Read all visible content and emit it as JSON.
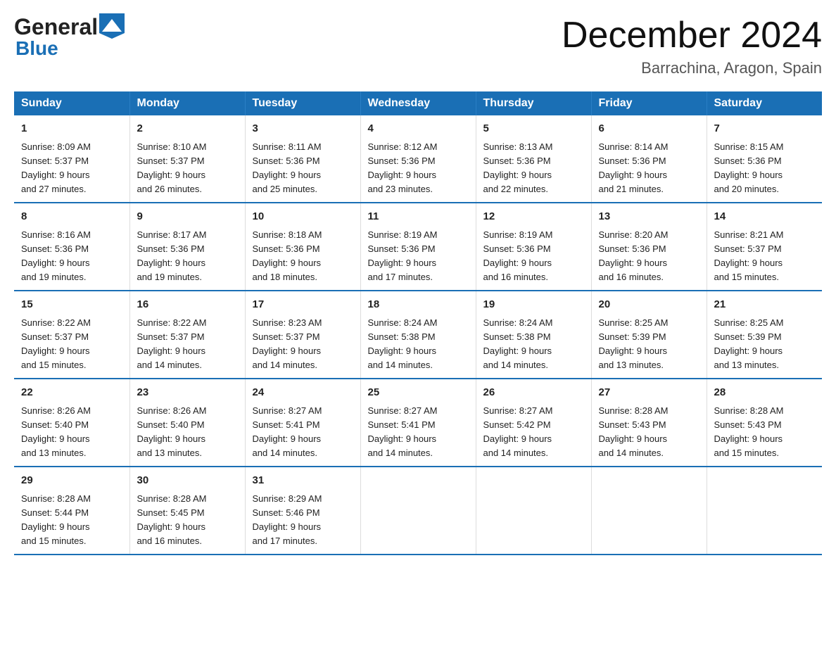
{
  "header": {
    "logo_general": "General",
    "logo_blue": "Blue",
    "title": "December 2024",
    "location": "Barrachina, Aragon, Spain"
  },
  "days_of_week": [
    "Sunday",
    "Monday",
    "Tuesday",
    "Wednesday",
    "Thursday",
    "Friday",
    "Saturday"
  ],
  "weeks": [
    [
      {
        "day": "1",
        "sunrise": "8:09 AM",
        "sunset": "5:37 PM",
        "daylight": "9 hours and 27 minutes."
      },
      {
        "day": "2",
        "sunrise": "8:10 AM",
        "sunset": "5:37 PM",
        "daylight": "9 hours and 26 minutes."
      },
      {
        "day": "3",
        "sunrise": "8:11 AM",
        "sunset": "5:36 PM",
        "daylight": "9 hours and 25 minutes."
      },
      {
        "day": "4",
        "sunrise": "8:12 AM",
        "sunset": "5:36 PM",
        "daylight": "9 hours and 23 minutes."
      },
      {
        "day": "5",
        "sunrise": "8:13 AM",
        "sunset": "5:36 PM",
        "daylight": "9 hours and 22 minutes."
      },
      {
        "day": "6",
        "sunrise": "8:14 AM",
        "sunset": "5:36 PM",
        "daylight": "9 hours and 21 minutes."
      },
      {
        "day": "7",
        "sunrise": "8:15 AM",
        "sunset": "5:36 PM",
        "daylight": "9 hours and 20 minutes."
      }
    ],
    [
      {
        "day": "8",
        "sunrise": "8:16 AM",
        "sunset": "5:36 PM",
        "daylight": "9 hours and 19 minutes."
      },
      {
        "day": "9",
        "sunrise": "8:17 AM",
        "sunset": "5:36 PM",
        "daylight": "9 hours and 19 minutes."
      },
      {
        "day": "10",
        "sunrise": "8:18 AM",
        "sunset": "5:36 PM",
        "daylight": "9 hours and 18 minutes."
      },
      {
        "day": "11",
        "sunrise": "8:19 AM",
        "sunset": "5:36 PM",
        "daylight": "9 hours and 17 minutes."
      },
      {
        "day": "12",
        "sunrise": "8:19 AM",
        "sunset": "5:36 PM",
        "daylight": "9 hours and 16 minutes."
      },
      {
        "day": "13",
        "sunrise": "8:20 AM",
        "sunset": "5:36 PM",
        "daylight": "9 hours and 16 minutes."
      },
      {
        "day": "14",
        "sunrise": "8:21 AM",
        "sunset": "5:37 PM",
        "daylight": "9 hours and 15 minutes."
      }
    ],
    [
      {
        "day": "15",
        "sunrise": "8:22 AM",
        "sunset": "5:37 PM",
        "daylight": "9 hours and 15 minutes."
      },
      {
        "day": "16",
        "sunrise": "8:22 AM",
        "sunset": "5:37 PM",
        "daylight": "9 hours and 14 minutes."
      },
      {
        "day": "17",
        "sunrise": "8:23 AM",
        "sunset": "5:37 PM",
        "daylight": "9 hours and 14 minutes."
      },
      {
        "day": "18",
        "sunrise": "8:24 AM",
        "sunset": "5:38 PM",
        "daylight": "9 hours and 14 minutes."
      },
      {
        "day": "19",
        "sunrise": "8:24 AM",
        "sunset": "5:38 PM",
        "daylight": "9 hours and 14 minutes."
      },
      {
        "day": "20",
        "sunrise": "8:25 AM",
        "sunset": "5:39 PM",
        "daylight": "9 hours and 13 minutes."
      },
      {
        "day": "21",
        "sunrise": "8:25 AM",
        "sunset": "5:39 PM",
        "daylight": "9 hours and 13 minutes."
      }
    ],
    [
      {
        "day": "22",
        "sunrise": "8:26 AM",
        "sunset": "5:40 PM",
        "daylight": "9 hours and 13 minutes."
      },
      {
        "day": "23",
        "sunrise": "8:26 AM",
        "sunset": "5:40 PM",
        "daylight": "9 hours and 13 minutes."
      },
      {
        "day": "24",
        "sunrise": "8:27 AM",
        "sunset": "5:41 PM",
        "daylight": "9 hours and 14 minutes."
      },
      {
        "day": "25",
        "sunrise": "8:27 AM",
        "sunset": "5:41 PM",
        "daylight": "9 hours and 14 minutes."
      },
      {
        "day": "26",
        "sunrise": "8:27 AM",
        "sunset": "5:42 PM",
        "daylight": "9 hours and 14 minutes."
      },
      {
        "day": "27",
        "sunrise": "8:28 AM",
        "sunset": "5:43 PM",
        "daylight": "9 hours and 14 minutes."
      },
      {
        "day": "28",
        "sunrise": "8:28 AM",
        "sunset": "5:43 PM",
        "daylight": "9 hours and 15 minutes."
      }
    ],
    [
      {
        "day": "29",
        "sunrise": "8:28 AM",
        "sunset": "5:44 PM",
        "daylight": "9 hours and 15 minutes."
      },
      {
        "day": "30",
        "sunrise": "8:28 AM",
        "sunset": "5:45 PM",
        "daylight": "9 hours and 16 minutes."
      },
      {
        "day": "31",
        "sunrise": "8:29 AM",
        "sunset": "5:46 PM",
        "daylight": "9 hours and 17 minutes."
      },
      null,
      null,
      null,
      null
    ]
  ],
  "labels": {
    "sunrise": "Sunrise:",
    "sunset": "Sunset:",
    "daylight": "Daylight:"
  }
}
